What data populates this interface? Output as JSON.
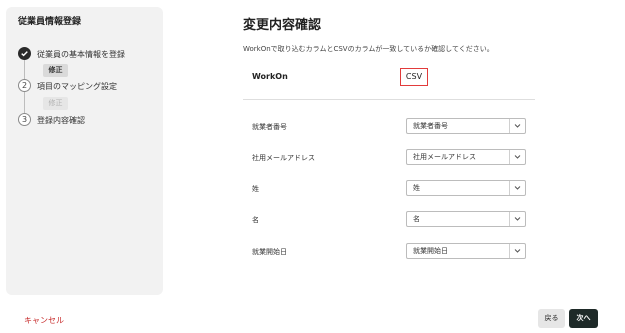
{
  "sidebar": {
    "title": "従業員情報登録",
    "steps": [
      {
        "number": "1",
        "label": "従業員の基本情報を登録",
        "status": "done",
        "fix_label": "修正"
      },
      {
        "number": "2",
        "label": "項目のマッピング設定",
        "status": "todo",
        "fix_label": "修正"
      },
      {
        "number": "3",
        "label": "登録内容確認",
        "status": "todo"
      }
    ]
  },
  "main": {
    "title": "変更内容確認",
    "description": "WorkOnで取り込むカラムとCSVのカラムが一致しているか確認してください。",
    "headers": {
      "workon": "WorkOn",
      "csv": "CSV"
    },
    "rows": [
      {
        "label": "就業者番号",
        "value": "就業者番号"
      },
      {
        "label": "社用メールアドレス",
        "value": "社用メールアドレス"
      },
      {
        "label": "姓",
        "value": "姓"
      },
      {
        "label": "名",
        "value": "名"
      },
      {
        "label": "就業開始日",
        "value": "就業開始日"
      }
    ]
  },
  "footer": {
    "cancel_label": "キャンセル",
    "back_label": "戻る",
    "next_label": "次へ"
  },
  "icons": {
    "check": "check-icon",
    "chevron": "chevron-down-icon"
  },
  "colors": {
    "highlight": "#e23b3b",
    "primary_button": "#1e2a28",
    "cancel_text": "#c62828"
  }
}
